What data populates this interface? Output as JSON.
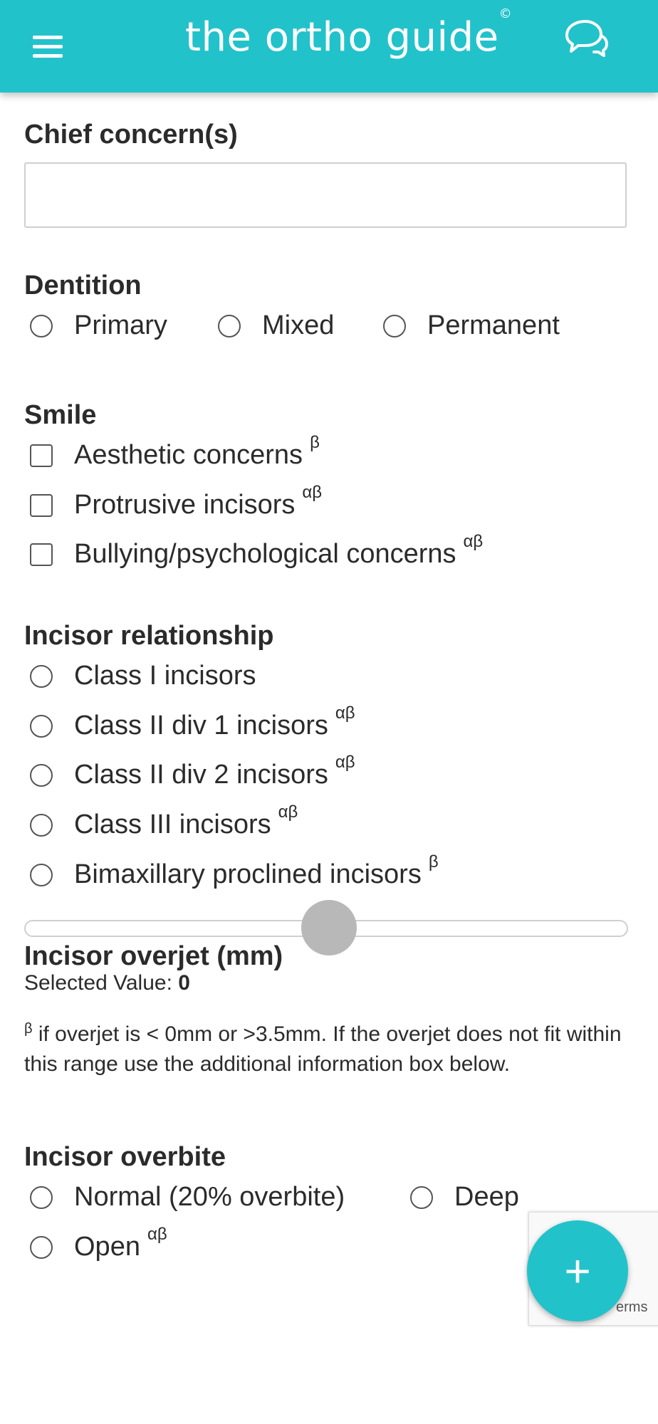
{
  "header": {
    "logo_text": "the ortho guide",
    "logo_mark": "©",
    "menu_icon": "hamburger-icon",
    "chat_icon": "chat-bubbles-icon",
    "brand_color": "#22c2cb"
  },
  "chief": {
    "label": "Chief concern(s)",
    "value": ""
  },
  "dentition": {
    "label": "Dentition",
    "options": [
      "Primary",
      "Mixed",
      "Permanent"
    ]
  },
  "smile": {
    "label": "Smile",
    "options": [
      {
        "label": "Aesthetic concerns",
        "sup": "β"
      },
      {
        "label": "Protrusive incisors",
        "sup": "αβ"
      },
      {
        "label": "Bullying/psychological concerns",
        "sup": "αβ"
      }
    ]
  },
  "incisor_rel": {
    "label": "Incisor relationship",
    "options": [
      {
        "label": "Class I incisors",
        "sup": ""
      },
      {
        "label": "Class II div 1 incisors",
        "sup": "αβ"
      },
      {
        "label": "Class II div 2 incisors",
        "sup": "αβ"
      },
      {
        "label": "Class III incisors",
        "sup": "αβ"
      },
      {
        "label": "Bimaxillary proclined incisors",
        "sup": "β"
      }
    ]
  },
  "overjet": {
    "label": "Incisor overjet (mm)",
    "selected_prefix": "Selected Value: ",
    "selected_value": "0",
    "slider_fraction": 0.5,
    "note_sup": "β",
    "note": " if overjet is < 0mm or >3.5mm. If the overjet does not fit within this range use the additional information box below."
  },
  "overbite": {
    "label": "Incisor overbite",
    "options": [
      {
        "label": "Normal (20% overbite)",
        "sup": ""
      },
      {
        "label": "Deep",
        "sup": ""
      },
      {
        "label": "Open",
        "sup": "αβ"
      }
    ]
  },
  "recaptcha": {
    "terms": "erms"
  },
  "fab": {
    "label": "+"
  }
}
